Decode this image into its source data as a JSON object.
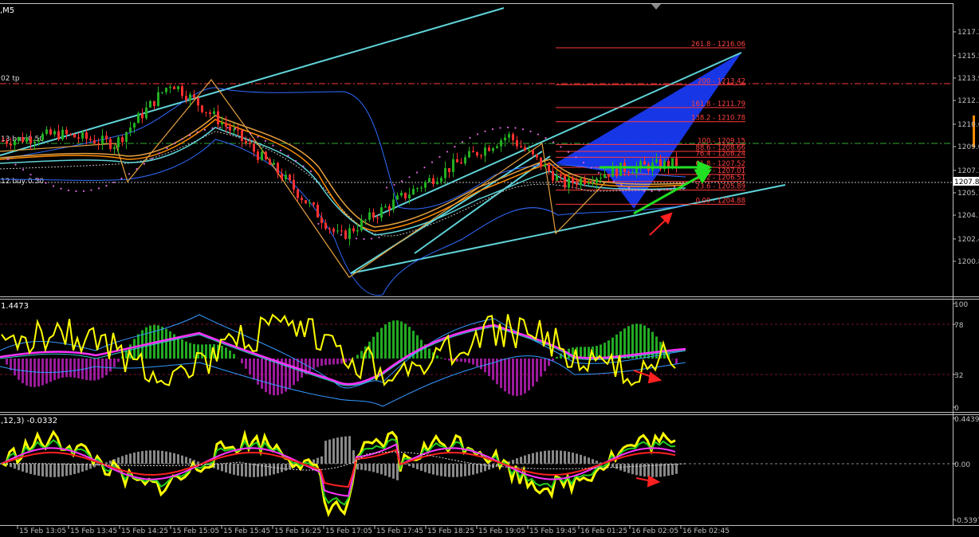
{
  "window": {
    "title_suffix": ",M5",
    "colors": {
      "background": "#000000",
      "frame": "#c0c0c0",
      "bull_candle": "#22b022",
      "bear_candle": "#ff3030",
      "channel": "#5fd3d8",
      "fib": "#ff3a3a",
      "bollinger": "#2f6bff",
      "triangle": "#1a3cff",
      "green_arrow": "#22e022",
      "yellow": "#ffff00",
      "magenta": "#ff33ff",
      "rsi_band": "#7a1030"
    },
    "price_tag": "1207.8"
  },
  "price_panel": {
    "labels": {
      "tp": "02 tp",
      "buy1": "13 buy 0.50",
      "buy2": "12 buy 0.50"
    },
    "axis_ticks": [
      "1217.2",
      "1215.5",
      "1213.9",
      "1212.3",
      "1210.6",
      "1209.0",
      "1207.3",
      "1205.7",
      "1204.1",
      "1202.4",
      "1200.8"
    ],
    "fib_levels": [
      {
        "label": "261.8 - 1216.06",
        "value": 1216.06
      },
      {
        "label": "200 - 1213.42",
        "value": 1213.42
      },
      {
        "label": "161.8 - 1211.79",
        "value": 1211.79
      },
      {
        "label": "138.2 - 1210.78",
        "value": 1210.78
      },
      {
        "label": "100 - 1209.15",
        "value": 1209.15
      },
      {
        "label": "88.6 - 1208.66",
        "value": 1208.66
      },
      {
        "label": "76.4 - 1208.24",
        "value": 1208.24
      },
      {
        "label": "61.8 - 1207.52",
        "value": 1207.52
      },
      {
        "label": "50.0 - 1207.01",
        "value": 1207.01
      },
      {
        "label": "38.2 - 1206.51",
        "value": 1206.51
      },
      {
        "label": "23.6 - 1205.89",
        "value": 1205.89
      },
      {
        "label": "0.00 - 1204.88",
        "value": 1204.88
      }
    ]
  },
  "rsi_panel": {
    "label": "1.4473",
    "axis_ticks": [
      "100",
      "78",
      "32",
      "0"
    ]
  },
  "macd_panel": {
    "label": ",12,3) -0.0332",
    "axis_ticks": [
      "0.4439",
      "0.00",
      "-0.5397"
    ]
  },
  "time_axis": [
    "15 Feb 13:05",
    "15 Feb 13:45",
    "15 Feb 14:25",
    "15 Feb 15:05",
    "15 Feb 15:45",
    "15 Feb 16:25",
    "15 Feb 17:05",
    "15 Feb 17:45",
    "15 Feb 18:25",
    "15 Feb 19:05",
    "15 Feb 19:45",
    "16 Feb 01:25",
    "16 Feb 02:05",
    "16 Feb 02:45"
  ],
  "chart_data": {
    "type": "line",
    "title": "",
    "xlabel": "",
    "ylabel": "",
    "x": [
      "15 Feb 13:05",
      "15 Feb 13:45",
      "15 Feb 14:25",
      "15 Feb 15:05",
      "15 Feb 15:45",
      "15 Feb 16:25",
      "15 Feb 17:05",
      "15 Feb 17:45",
      "15 Feb 18:25",
      "15 Feb 19:05",
      "15 Feb 19:45",
      "16 Feb 01:25",
      "16 Feb 02:05"
    ],
    "series": [
      {
        "values": [
          1209.4,
          1209.9,
          1209.2,
          1213.6,
          1210.4,
          1206.8,
          1202.5,
          1205.1,
          1207.6,
          1209.8,
          1206.3,
          1207.4,
          1207.8
        ]
      }
    ],
    "ylim": [
      1200.8,
      1218.0
    ]
  }
}
